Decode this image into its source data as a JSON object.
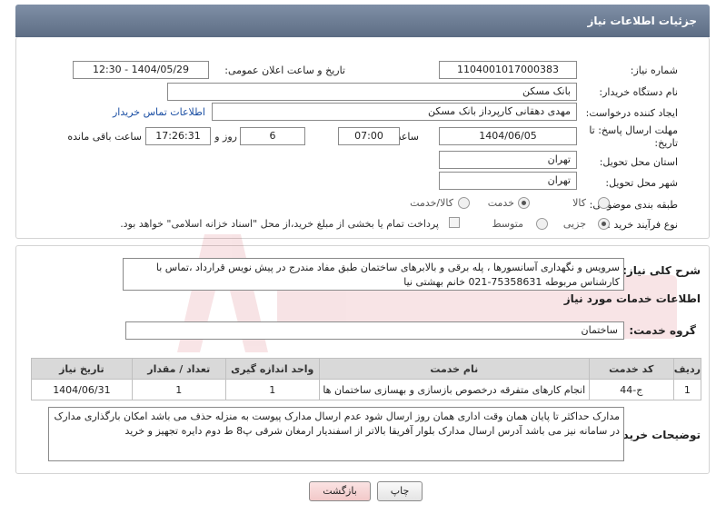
{
  "header": {
    "title": "جزئیات اطلاعات نیاز"
  },
  "form": {
    "need_number_label": "شماره نیاز:",
    "need_number": "1104001017000383",
    "announce_label": "تاریخ و ساعت اعلان عمومی:",
    "announce_value": "1404/05/29 - 12:30",
    "buyer_org_label": "نام دستگاه خریدار:",
    "buyer_org": "بانک مسکن",
    "requester_label": "ایجاد کننده درخواست:",
    "requester": "مهدی دهقانی کارپرداز بانک مسکن",
    "contact_link": "اطلاعات تماس خریدار",
    "deadline_label_1": "مهلت ارسال پاسخ: تا",
    "deadline_label_2": "تاریخ:",
    "deadline_date": "1404/06/05",
    "time_label": "ساعت",
    "deadline_time": "07:00",
    "days_value": "6",
    "days_label": "روز و",
    "remaining_time": "17:26:31",
    "remaining_label": "ساعت باقی مانده",
    "province_label": "استان محل تحویل:",
    "province": "تهران",
    "city_label": "شهر محل تحویل:",
    "city": "تهران",
    "category_label": "طبقه بندی موضوعی:",
    "category_options": [
      "کالا",
      "خدمت",
      "کالا/خدمت"
    ],
    "category_selected": "خدمت",
    "process_label": "نوع فرآیند خرید :",
    "process_options": [
      "جزیی",
      "متوسط"
    ],
    "process_selected": "جزیی",
    "payment_note": "پرداخت تمام یا بخشی از مبلغ خرید،از محل \"اسناد خزانه اسلامی\" خواهد بود."
  },
  "summary": {
    "label": "شرح کلی نیاز:",
    "text": "سرویس و نگهداری آسانسورها ، پله برقی و بالابرهای ساختمان طبق مفاد مندرج در پیش نویس قرارداد ،تماس با کارشناس مربوطه 75358631-021 خانم بهشتی نیا"
  },
  "services": {
    "section_title": "اطلاعات خدمات مورد نیاز",
    "group_label": "گروه خدمت:",
    "group_value": "ساختمان",
    "columns": [
      "ردیف",
      "کد خدمت",
      "نام خدمت",
      "واحد اندازه گیری",
      "تعداد / مقدار",
      "تاریخ نیاز"
    ],
    "rows": [
      [
        "1",
        "ج-44",
        "انجام کارهای متفرقه درخصوص بازسازی و بهسازی ساختمان ها",
        "1",
        "1",
        "1404/06/31"
      ]
    ]
  },
  "buyer_notes": {
    "label": "توضیحات خریدار:",
    "text": "مدارک حداکثر تا پایان همان وقت اداری همان روز ارسال شود عدم ارسال مدارک پیوست به منزله حذف می باشد امکان بارگذاری مدارک در سامانه نیز می باشد آدرس ارسال مدارک بلوار آفریقا بالاتر از اسفندیار ارمغان شرقی پ8 ط دوم دایره تجهیز و خرید"
  },
  "buttons": {
    "print": "چاپ",
    "back": "بازگشت"
  },
  "colors": {
    "header": "#6b7b92",
    "link": "#1a4ea3",
    "back_button": "#f2c9c9"
  }
}
